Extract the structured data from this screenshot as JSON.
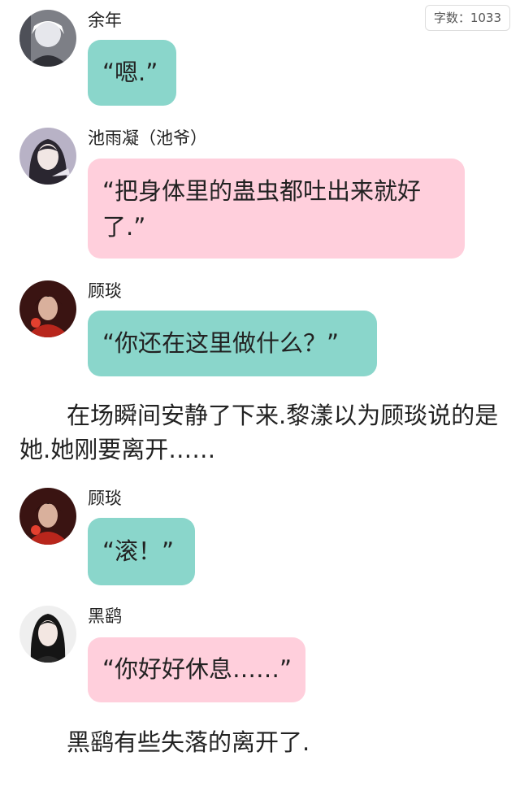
{
  "word_count": "字数：1033",
  "colors": {
    "teal_bubble": "#8ad6cb",
    "pink_bubble": "#ffcfdc"
  },
  "messages": [
    {
      "name": "余年",
      "text": "“嗯.”",
      "bubble": "teal",
      "avatar": "white-hair-avatar"
    },
    {
      "name": "池雨凝（池爷）",
      "text": "“把身体里的蛊虫都吐出来就好了.”",
      "bubble": "pink",
      "avatar": "dark-hair-girl-avatar"
    },
    {
      "name": "顾琰",
      "text": "“你还在这里做什么？”",
      "bubble": "teal",
      "avatar": "red-dark-avatar"
    }
  ],
  "narration_1": "在场瞬间安静了下来.黎漾以为顾琰说的是她.她刚要离开……",
  "messages_2": [
    {
      "name": "顾琰",
      "text": "“滚！”",
      "bubble": "teal",
      "avatar": "red-dark-avatar"
    },
    {
      "name": "黑鹞",
      "text": "“你好好休息……”",
      "bubble": "pink",
      "avatar": "long-black-hair-avatar"
    }
  ],
  "narration_2": "黑鹞有些失落的离开了."
}
